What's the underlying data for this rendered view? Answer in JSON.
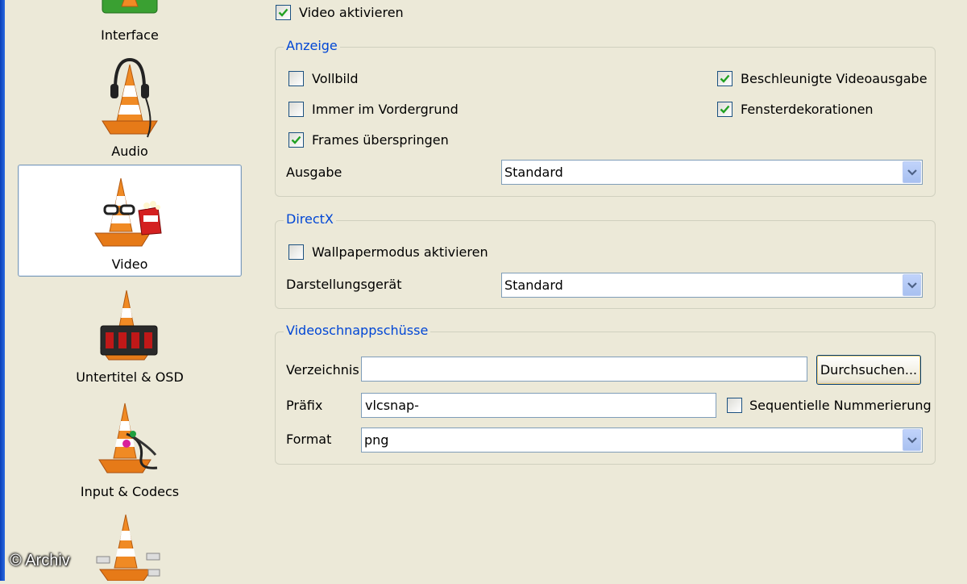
{
  "sidebar": {
    "items": [
      {
        "label": "Interface",
        "icon": "interface-icon"
      },
      {
        "label": "Audio",
        "icon": "audio-headphones-icon"
      },
      {
        "label": "Video",
        "icon": "video-glasses-icon",
        "selected": true
      },
      {
        "label": "Untertitel & OSD",
        "icon": "subtitle-display-icon"
      },
      {
        "label": "Input & Codecs",
        "icon": "input-cables-icon"
      },
      {
        "label": "",
        "icon": "network-icon"
      }
    ]
  },
  "video_enable": {
    "label": "Video aktivieren",
    "checked": true
  },
  "anzeige": {
    "title": "Anzeige",
    "vollbild": {
      "label": "Vollbild",
      "checked": false
    },
    "immer_vordergrund": {
      "label": "Immer im Vordergrund",
      "checked": false
    },
    "frames_ueberspringen": {
      "label": "Frames überspringen",
      "checked": true
    },
    "beschleunigt": {
      "label": "Beschleunigte Videoausgabe",
      "checked": true
    },
    "fensterdekorationen": {
      "label": "Fensterdekorationen",
      "checked": true
    },
    "ausgabe_label": "Ausgabe",
    "ausgabe_value": "Standard"
  },
  "directx": {
    "title": "DirectX",
    "wallpaper": {
      "label": "Wallpapermodus aktivieren",
      "checked": false
    },
    "geraet_label": "Darstellungsgerät",
    "geraet_value": "Standard"
  },
  "snapshots": {
    "title": "Videoschnappschüsse",
    "verzeichnis_label": "Verzeichnis",
    "verzeichnis_value": "",
    "browse_label": "Durchsuchen...",
    "praefix_label": "Präfix",
    "praefix_value": "vlcsnap-",
    "sequentiell": {
      "label": "Sequentielle Nummerierung",
      "checked": false
    },
    "format_label": "Format",
    "format_value": "png"
  },
  "watermark": "© Archiv",
  "colors": {
    "accent": "#0046d5",
    "background": "#ece9d8",
    "cone_orange": "#f08a24"
  }
}
